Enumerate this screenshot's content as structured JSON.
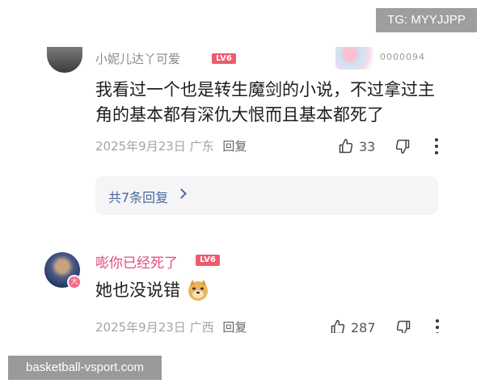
{
  "watermarks": {
    "tg": "TG: MYYJJPP",
    "site": "basketball-vsport.com"
  },
  "comment1": {
    "username": "小妮儿达丫可爱",
    "level": "LV6",
    "decor_code": "0000094",
    "text": "我看过一个也是转生魔剑的小说，不过拿过主角的基本都有深仇大恨而且基本都死了",
    "date": "2025年9月23日",
    "location": "广东",
    "reply_label": "回复",
    "likes": "33",
    "replies_link": "共7条回复"
  },
  "comment2": {
    "username": "嘭你已经死了",
    "level": "LV6",
    "badge": "大",
    "text": "她也没说错",
    "emoji": "doge-emoji",
    "date": "2025年9月23日",
    "location": "广西",
    "reply_label": "回复",
    "likes": "287"
  },
  "colors": {
    "accent_name": "#e04b7e",
    "level_badge": "#ef5a6f",
    "link": "#4b6a9a",
    "meta": "#a4a4a4"
  }
}
